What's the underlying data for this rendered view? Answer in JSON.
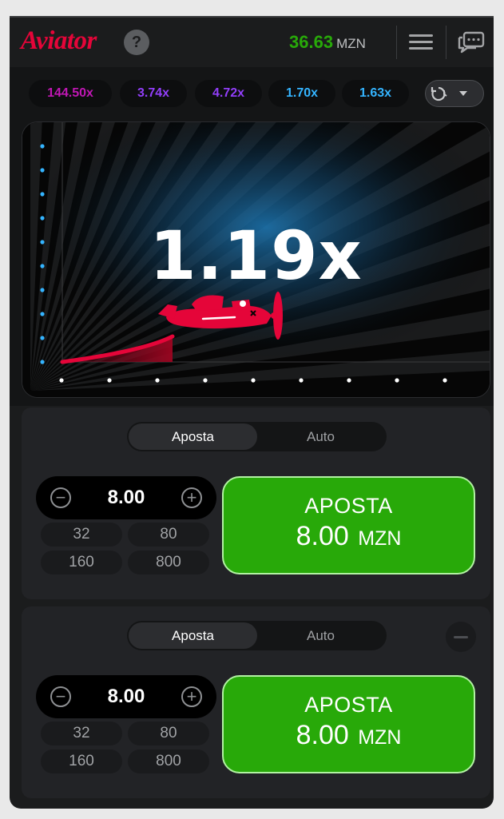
{
  "header": {
    "logo": "Aviator",
    "help_label": "?",
    "balance_amount": "36.63",
    "balance_currency": "MZN"
  },
  "history": [
    {
      "value": "144.50x",
      "color": "#c017b4"
    },
    {
      "value": "3.74x",
      "color": "#913ef8"
    },
    {
      "value": "4.72x",
      "color": "#913ef8"
    },
    {
      "value": "1.70x",
      "color": "#34b4ff"
    },
    {
      "value": "1.63x",
      "color": "#34b4ff"
    }
  ],
  "game": {
    "multiplier": "1.19x"
  },
  "panels": [
    {
      "tab_active": "Aposta",
      "tab_inactive": "Auto",
      "stake": "8.00",
      "quick": [
        "32",
        "80",
        "160",
        "800"
      ],
      "button_line1": "APOSTA",
      "button_amount": "8.00",
      "button_currency": "MZN"
    },
    {
      "tab_active": "Aposta",
      "tab_inactive": "Auto",
      "stake": "8.00",
      "quick": [
        "32",
        "80",
        "160",
        "800"
      ],
      "button_line1": "APOSTA",
      "button_amount": "8.00",
      "button_currency": "MZN"
    }
  ],
  "colors": {
    "accent_red": "#e50539",
    "bet_green": "#28a909",
    "balance_green": "#28a909"
  }
}
